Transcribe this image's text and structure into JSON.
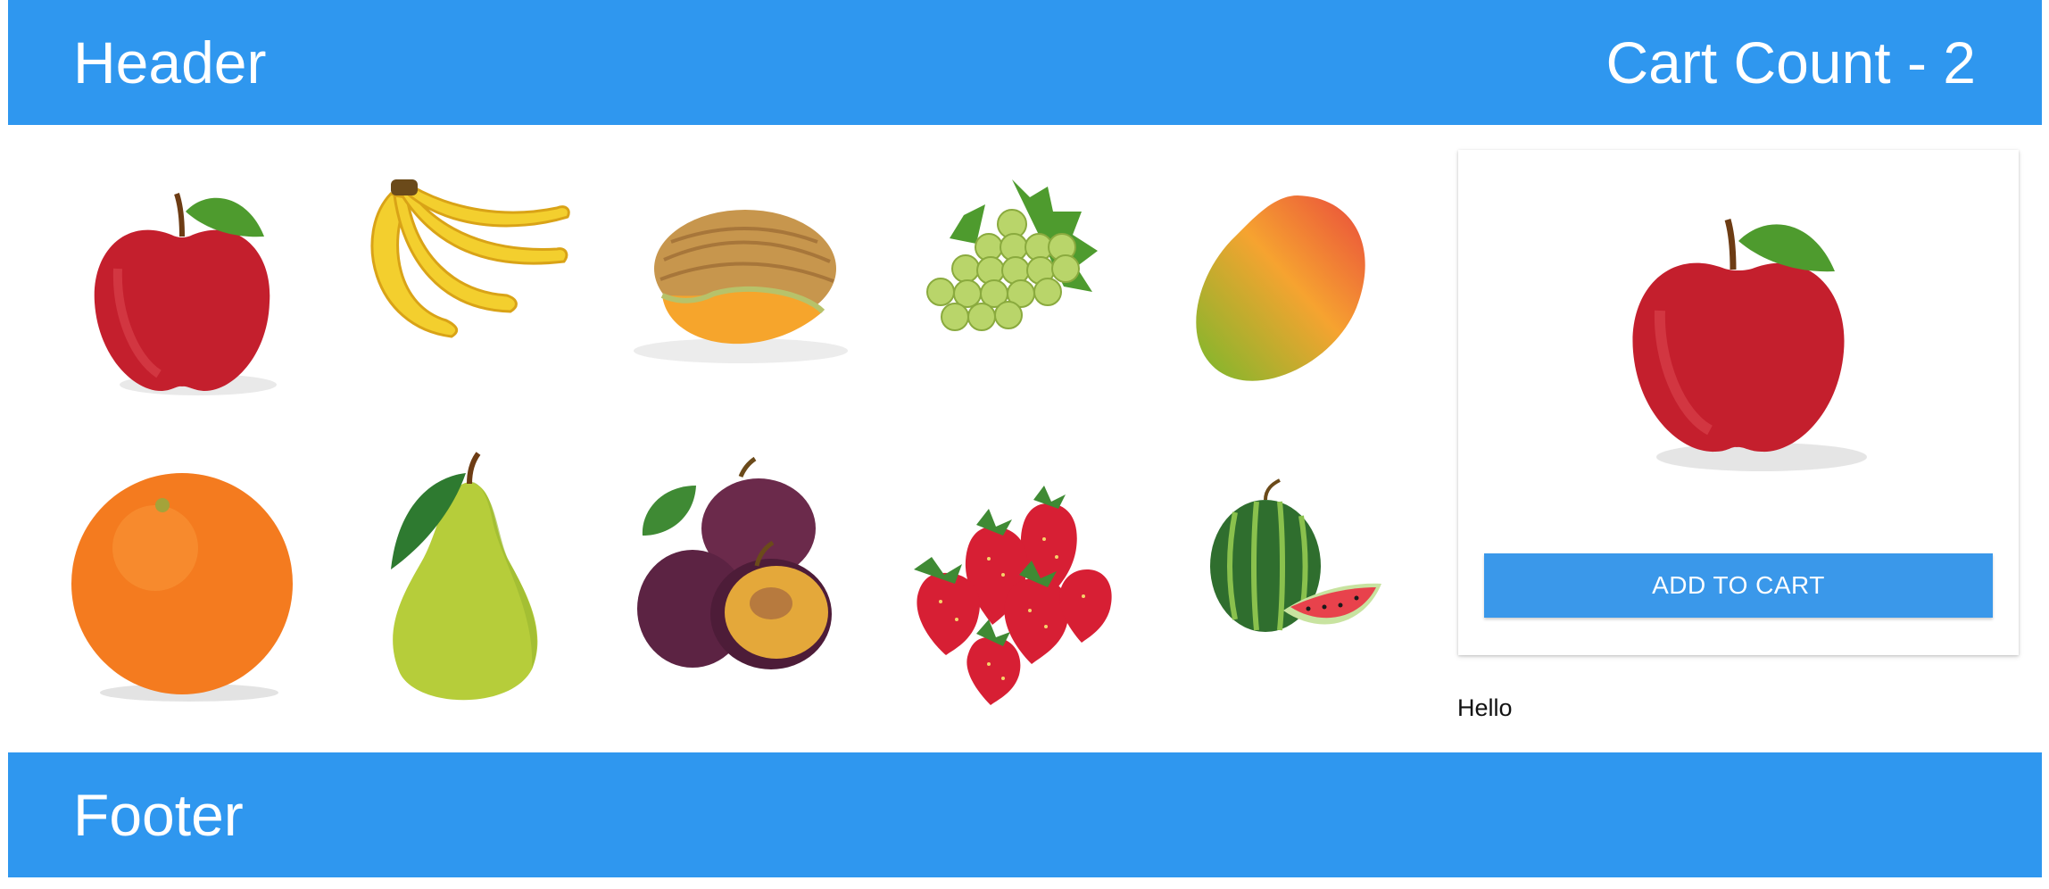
{
  "header": {
    "title": "Header",
    "cart_count": "Cart Count - 2"
  },
  "products": [
    {
      "name": "apple",
      "icon": "apple-icon"
    },
    {
      "name": "banana",
      "icon": "banana-icon"
    },
    {
      "name": "cantaloupe",
      "icon": "cantaloupe-icon"
    },
    {
      "name": "grapes",
      "icon": "grapes-icon"
    },
    {
      "name": "mango",
      "icon": "mango-icon"
    },
    {
      "name": "orange",
      "icon": "orange-icon"
    },
    {
      "name": "pear",
      "icon": "pear-icon"
    },
    {
      "name": "plum",
      "icon": "plum-icon"
    },
    {
      "name": "strawberry",
      "icon": "strawberry-icon"
    },
    {
      "name": "watermelon",
      "icon": "watermelon-icon"
    }
  ],
  "selected": {
    "image_icon": "apple-icon",
    "button_label": "ADD TO CART"
  },
  "note": "Hello",
  "footer": {
    "title": "Footer"
  },
  "colors": {
    "primary": "#2f97ef",
    "button": "#3a98ea"
  }
}
